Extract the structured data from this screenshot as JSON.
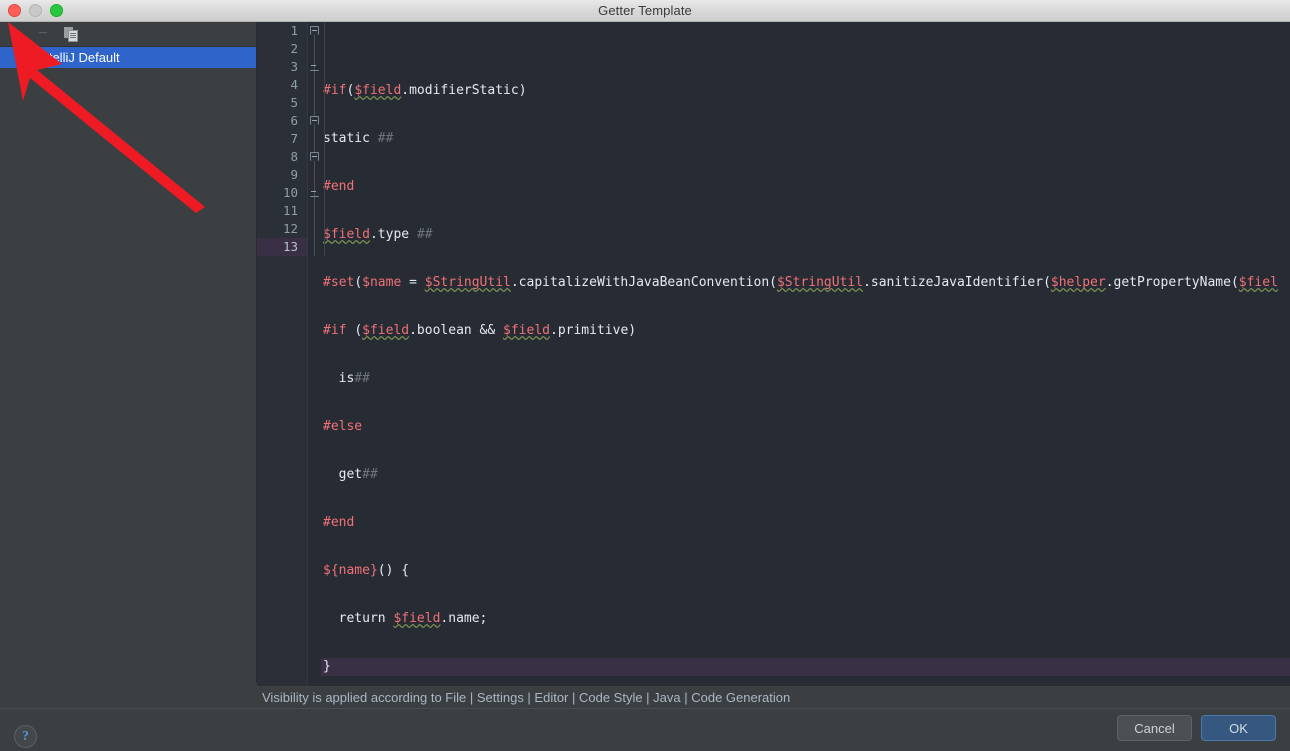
{
  "window": {
    "title": "Getter Template",
    "traffic_lights": [
      "close-button",
      "minimize-button",
      "zoom-button"
    ]
  },
  "sidebar": {
    "toolbar": {
      "add_label": "+",
      "remove_label": "−",
      "copy_label": "copy-icon"
    },
    "items": [
      {
        "label": "IntelliJ Default",
        "selected": true,
        "note": "leading text partially covered by red arrow overlay"
      }
    ]
  },
  "editor": {
    "language": "Velocity",
    "current_line": 13,
    "line_numbers": [
      "1",
      "2",
      "3",
      "4",
      "5",
      "6",
      "7",
      "8",
      "9",
      "10",
      "11",
      "12",
      "13"
    ],
    "lines": [
      {
        "n": 1,
        "text": "#if($field.modifierStatic)"
      },
      {
        "n": 2,
        "text": "static ##"
      },
      {
        "n": 3,
        "text": "#end"
      },
      {
        "n": 4,
        "text": "$field.type ##"
      },
      {
        "n": 5,
        "text": "#set($name = $StringUtil.capitalizeWithJavaBeanConvention($StringUtil.sanitizeJavaIdentifier($helper.getPropertyName($fiel"
      },
      {
        "n": 6,
        "text": "#if ($field.boolean && $field.primitive)"
      },
      {
        "n": 7,
        "text": "  is##"
      },
      {
        "n": 8,
        "text": "#else"
      },
      {
        "n": 9,
        "text": "  get##"
      },
      {
        "n": 10,
        "text": "#end"
      },
      {
        "n": 11,
        "text": "${name}() {"
      },
      {
        "n": 12,
        "text": "  return $field.name;"
      },
      {
        "n": 13,
        "text": "}"
      }
    ]
  },
  "status": {
    "message": "Visibility is applied according to File | Settings | Editor | Code Style | Java | Code Generation"
  },
  "footer": {
    "help_label": "?",
    "cancel_label": "Cancel",
    "ok_label": "OK"
  },
  "colors": {
    "accent_selection": "#2f65ca",
    "ok_button": "#365880",
    "editor_background": "#272b33",
    "panel_background": "#3c3f41",
    "directive": "#f07178",
    "comment": "#6d737d",
    "plain_text": "#e6e9ef",
    "line_number": "#8fa0a0",
    "current_line_highlight": "#393046",
    "annotation_arrow": "#ee1b24"
  }
}
